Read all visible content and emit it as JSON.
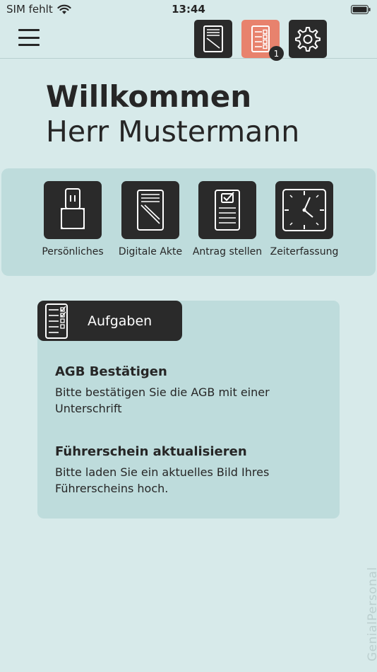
{
  "status_bar": {
    "carrier": "SIM fehlt",
    "time": "13:44"
  },
  "toolbar": {
    "badge_count": "1"
  },
  "welcome": {
    "title": "Willkommen",
    "name": "Herr Mustermann"
  },
  "tiles": [
    {
      "label": "Persönliches",
      "icon": "id-badge-icon"
    },
    {
      "label": "Digitale Akte",
      "icon": "document-file-icon"
    },
    {
      "label": "Antrag stellen",
      "icon": "form-check-icon"
    },
    {
      "label": "Zeiterfassung",
      "icon": "clock-icon"
    }
  ],
  "tasks": {
    "title": "Aufgaben",
    "items": [
      {
        "title": "AGB Bestätigen",
        "description": "Bitte bestätigen Sie die AGB mit einer Unterschrift"
      },
      {
        "title": "Führerschein aktualisieren",
        "description": "Bitte laden Sie ein aktuelles Bild Ihres Führerscheins hoch."
      }
    ]
  },
  "brand": "GenialPersonal",
  "colors": {
    "background": "#d7eaea",
    "panel": "#bedcdc",
    "dark": "#2a2a2a",
    "accent": "#e8826d"
  }
}
